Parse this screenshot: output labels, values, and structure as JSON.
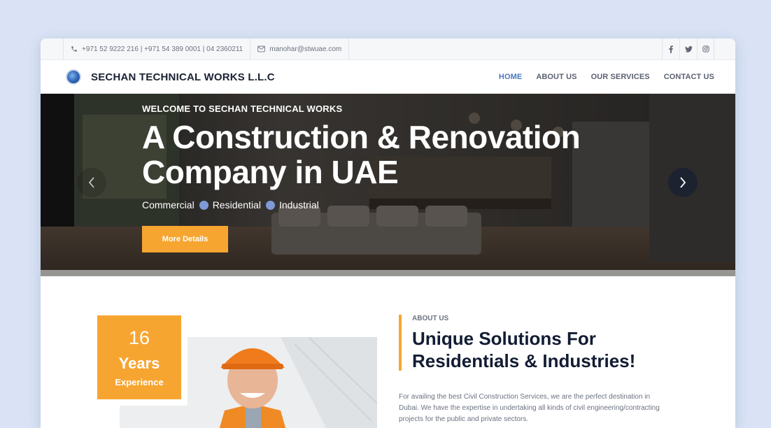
{
  "topbar": {
    "phone_icon": "phone-icon",
    "phone": "+971 52 9222 216 | +971 54 389 0001 | 04 2360211",
    "email_icon": "envelope-icon",
    "email": "manohar@stwuae.com",
    "social": [
      {
        "name": "facebook-icon",
        "glyph": "f"
      },
      {
        "name": "twitter-icon",
        "glyph": "t"
      },
      {
        "name": "instagram-icon",
        "glyph": "o"
      }
    ]
  },
  "nav": {
    "brand": "SECHAN TECHNICAL WORKS L.L.C",
    "links": [
      {
        "label": "HOME",
        "active": true
      },
      {
        "label": "ABOUT US",
        "active": false
      },
      {
        "label": "OUR SERVICES",
        "active": false
      },
      {
        "label": "CONTACT US",
        "active": false
      }
    ]
  },
  "hero": {
    "kicker": "WELCOME TO SECHAN TECHNICAL WORKS",
    "title_line1": "A Construction & Renovation",
    "title_line2": "Company in UAE",
    "tags": [
      "Commercial",
      "Residential",
      "Industrial"
    ],
    "button": "More Details"
  },
  "about": {
    "exp_number": "16",
    "exp_years": "Years",
    "exp_label": "Experience",
    "kicker": "ABOUT US",
    "title_line1": "Unique Solutions For",
    "title_line2": "Residentials & Industries!",
    "body": "For availing the best Civil Construction Services, we are the perfect destination in Dubai. We have the expertise in undertaking all kinds of civil engineering/contracting projects for the public and private sectors."
  },
  "colors": {
    "accent": "#f7a531",
    "nav_active": "#4a78c2",
    "dark": "#121c33",
    "tag_dot": "#7f99d6"
  }
}
